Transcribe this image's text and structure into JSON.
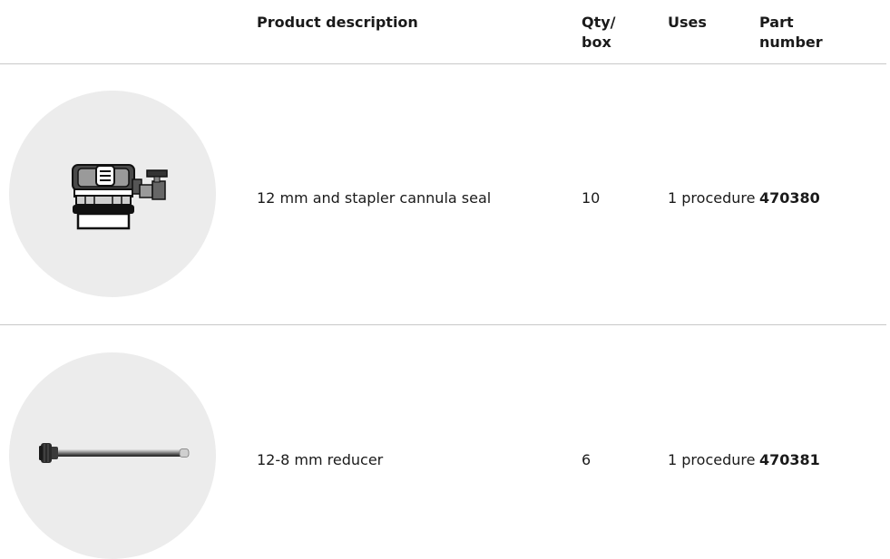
{
  "header": {
    "description": "Product description",
    "qty": "Qty/\nbox",
    "uses": "Uses",
    "part": "Part\nnumber"
  },
  "rows": [
    {
      "icon": "cannula-seal-image",
      "description": "12 mm and stapler cannula seal",
      "qty": "10",
      "uses": "1 procedure",
      "part": "470380"
    },
    {
      "icon": "reducer-image",
      "description": "12-8 mm reducer",
      "qty": "6",
      "uses": "1 procedure",
      "part": "470381"
    }
  ],
  "colors": {
    "circle": "#ececec",
    "rule": "#c8c8c8",
    "text": "#1a1a1a"
  }
}
